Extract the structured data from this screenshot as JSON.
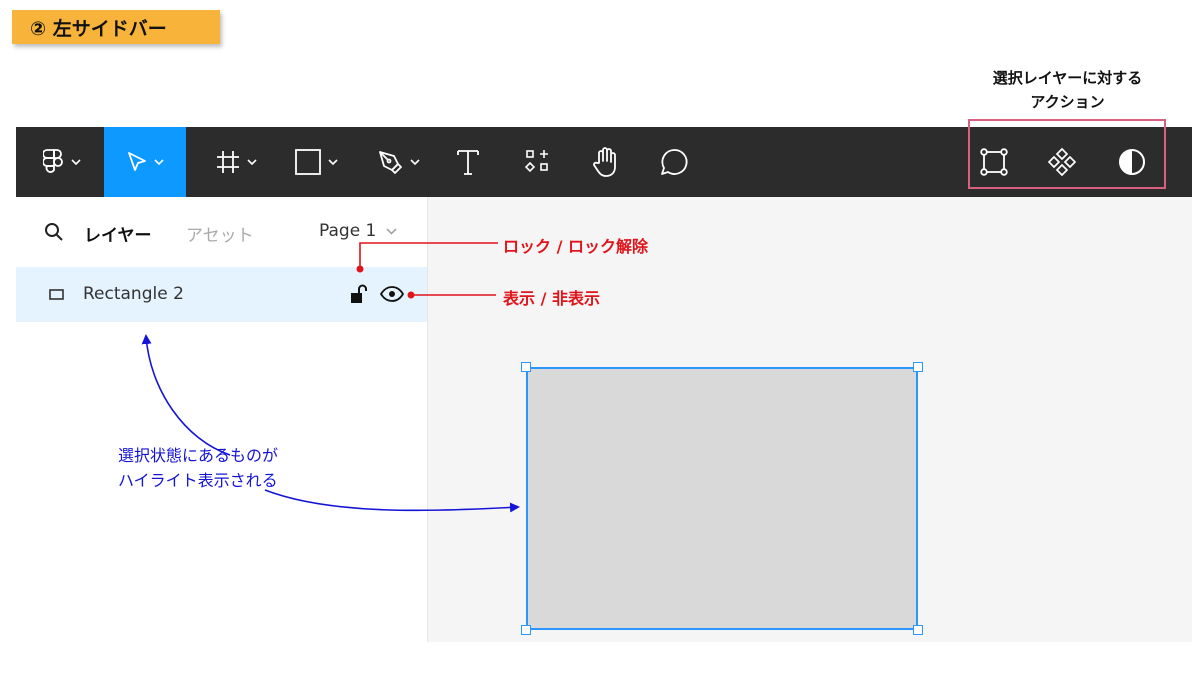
{
  "section_badge": "② 左サイドバー",
  "selection_actions_note": {
    "line1": "選択レイヤーに対する",
    "line2": "アクション"
  },
  "toolbar": {
    "tools": [
      {
        "name": "main-menu",
        "icon": "figma-logo-icon",
        "has_caret": true
      },
      {
        "name": "move",
        "icon": "move-cursor-icon",
        "has_caret": true,
        "active": true
      },
      {
        "name": "frame",
        "icon": "frame-hash-icon",
        "has_caret": true
      },
      {
        "name": "shape",
        "icon": "rectangle-icon",
        "has_caret": true
      },
      {
        "name": "pen",
        "icon": "pen-icon",
        "has_caret": true
      },
      {
        "name": "text",
        "icon": "text-icon",
        "has_caret": false
      },
      {
        "name": "resources",
        "icon": "resources-icon",
        "has_caret": false
      },
      {
        "name": "hand",
        "icon": "hand-icon",
        "has_caret": false
      },
      {
        "name": "comment",
        "icon": "comment-icon",
        "has_caret": false
      }
    ],
    "selection_actions": [
      {
        "name": "use-as-mask",
        "icon": "mask-frame-icon"
      },
      {
        "name": "create-component",
        "icon": "component-icon"
      },
      {
        "name": "mask",
        "icon": "half-circle-icon"
      }
    ],
    "active_color": "#0d99ff",
    "bar_color": "#2c2c2c"
  },
  "sidebar": {
    "tabs": {
      "layers": "レイヤー",
      "assets": "アセット"
    },
    "page": "Page 1",
    "layers": [
      {
        "name": "Rectangle 2",
        "type": "rectangle",
        "selected": true
      }
    ]
  },
  "annotations": {
    "lock": "ロック / ロック解除",
    "visibility": "表示 / 非表示",
    "highlight_line1": "選択状態にあるものが",
    "highlight_line2": "ハイライト表示される"
  },
  "colors": {
    "selection": "#2c96ff",
    "highlight_row": "#e5f3ff",
    "annotation_red": "#e0141b",
    "annotation_blue": "#1414d6",
    "badge": "#f7b33a",
    "action_box": "#d9607e"
  }
}
